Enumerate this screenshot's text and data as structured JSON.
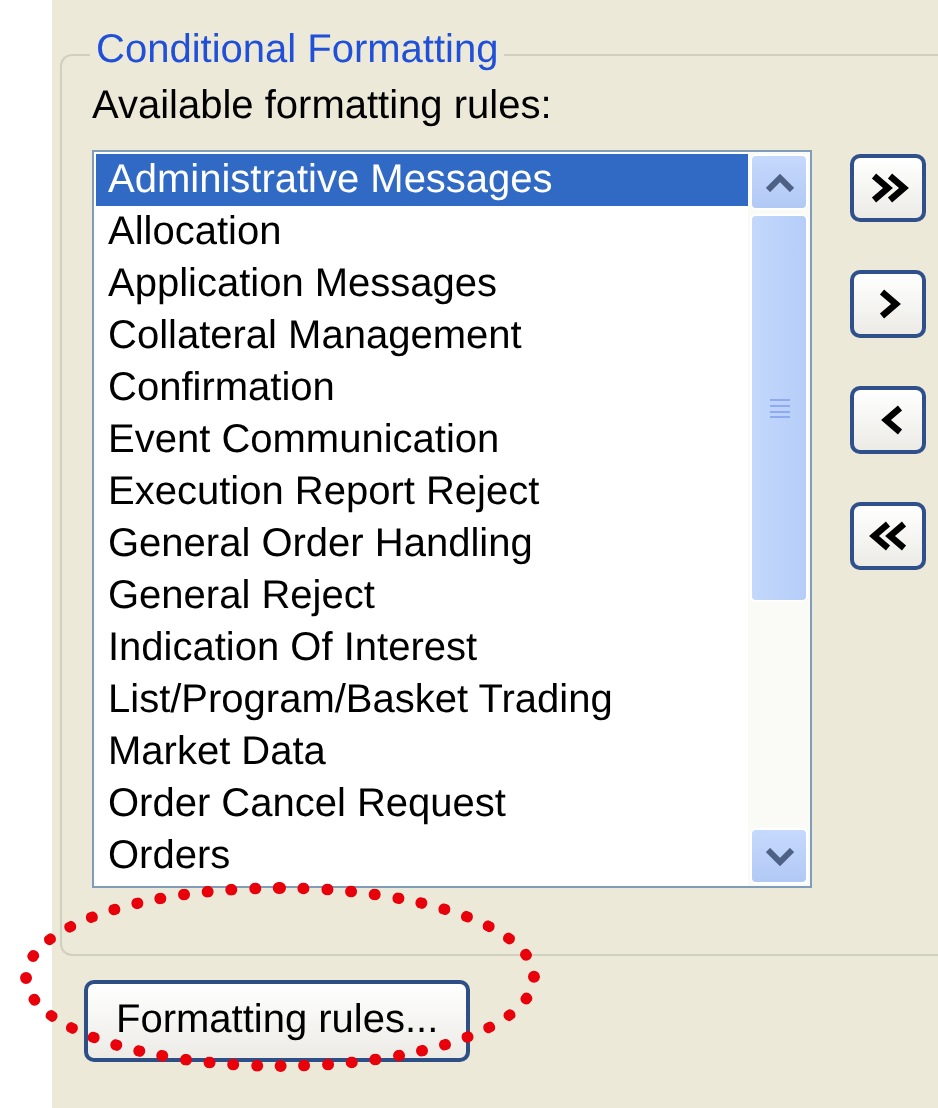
{
  "group": {
    "title": "Conditional Formatting",
    "label": "Available formatting rules:",
    "rules": [
      {
        "label": "Administrative Messages",
        "selected": true
      },
      {
        "label": "Allocation",
        "selected": false
      },
      {
        "label": "Application Messages",
        "selected": false
      },
      {
        "label": "Collateral Management",
        "selected": false
      },
      {
        "label": "Confirmation",
        "selected": false
      },
      {
        "label": "Event Communication",
        "selected": false
      },
      {
        "label": "Execution Report Reject",
        "selected": false
      },
      {
        "label": "General Order Handling",
        "selected": false
      },
      {
        "label": "General Reject",
        "selected": false
      },
      {
        "label": "Indication Of Interest",
        "selected": false
      },
      {
        "label": "List/Program/Basket Trading",
        "selected": false
      },
      {
        "label": "Market Data",
        "selected": false
      },
      {
        "label": "Order Cancel Request",
        "selected": false
      },
      {
        "label": "Orders",
        "selected": false
      }
    ]
  },
  "button": {
    "label": "Formatting rules..."
  }
}
